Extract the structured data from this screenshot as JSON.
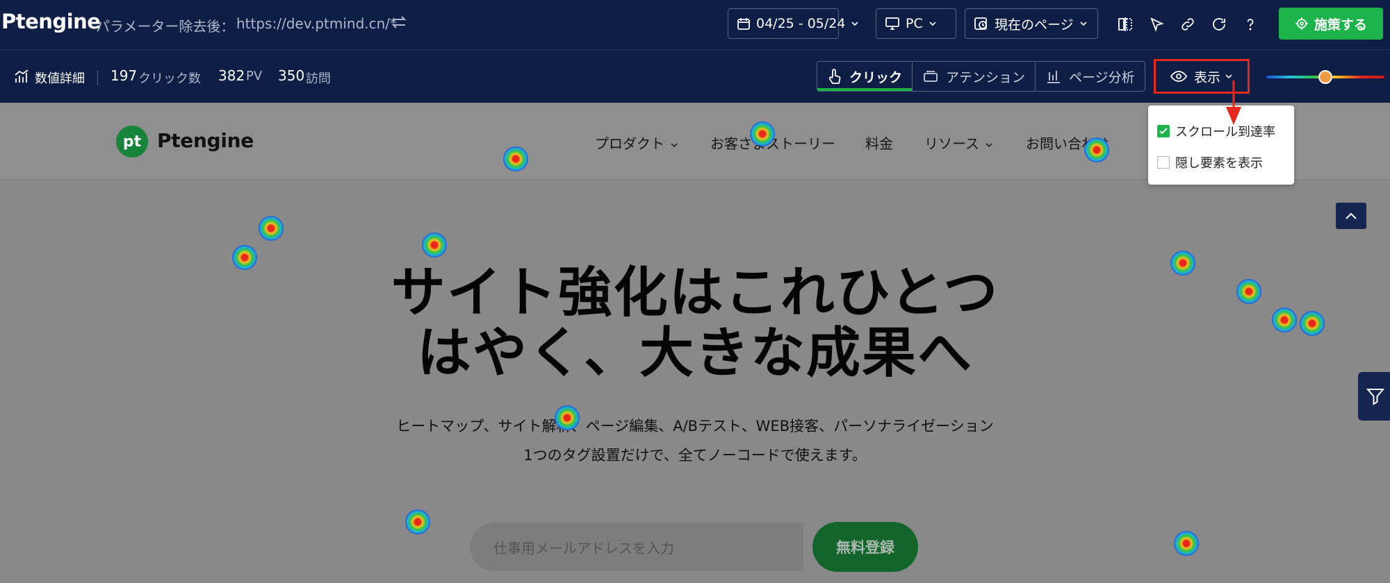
{
  "header": {
    "brand": "Ptengine",
    "url_prefix": "パラメーター除去後：",
    "url_value": "https://dev.ptmind.cn/*",
    "date_range": "04/25 - 05/24",
    "device": "PC",
    "page_scope": "現在のページ",
    "apply_label": "施策する"
  },
  "stats": {
    "label": "数値詳細",
    "clicks_value": "197",
    "clicks_unit": "クリック数",
    "pv_value": "382",
    "pv_unit": "PV",
    "visits_value": "350",
    "visits_unit": "訪問"
  },
  "modes": {
    "click": "クリック",
    "attention": "アテンション",
    "page_analysis": "ページ分析",
    "active": "click"
  },
  "display_menu": {
    "label": "表示",
    "options": [
      {
        "label": "スクロール到達率",
        "checked": true
      },
      {
        "label": "隠し要素を表示",
        "checked": false
      }
    ]
  },
  "heatmap_intensity": 0.5,
  "site": {
    "logo_mark": "pt",
    "logo_text": "Ptengine",
    "nav": [
      "プロダクト",
      "お客さまストーリー",
      "料金",
      "リソース",
      "お問い合わせ"
    ],
    "hero_line1": "サイト強化はこれひとつ",
    "hero_line2": "はやく、大きな成果へ",
    "sub_line1": "ヒートマップ、サイト解析、ページ編集、A/Bテスト、WEB接客、パーソナライゼーション",
    "sub_line2": "1つのタグ設置だけで、全てノーコードで使えます。",
    "email_placeholder": "仕事用メールアドレスを入力",
    "signup_label": "無料登録"
  },
  "colors": {
    "topbar": "#0e1e45",
    "accent_green": "#1bb34a",
    "highlight_red": "#e8281c"
  }
}
